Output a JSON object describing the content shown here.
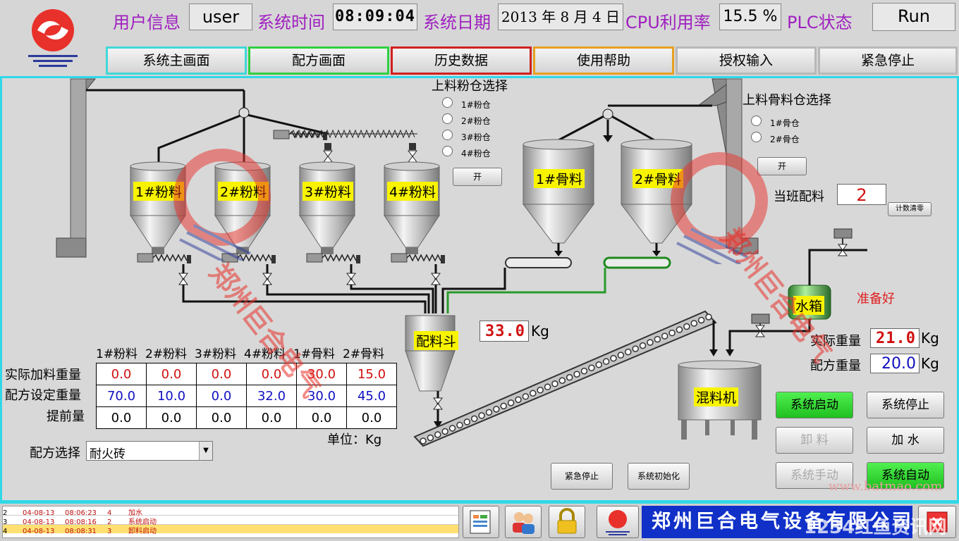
{
  "header": {
    "user_label": "用户信息",
    "user_value": "user",
    "time_label": "系统时间",
    "time_value": "08:09:04",
    "date_label": "系统日期",
    "date_value": "2013 年 8 月 4 日",
    "cpu_label": "CPU利用率",
    "cpu_value": "15.5 %",
    "plc_label": "PLC状态",
    "plc_value": "Run"
  },
  "nav": [
    {
      "label": "系统主画面",
      "color": "#40d8d8"
    },
    {
      "label": "配方画面",
      "color": "#30d040"
    },
    {
      "label": "历史数据",
      "color": "#d02020"
    },
    {
      "label": "使用帮助",
      "color": "#e8a020"
    },
    {
      "label": "授权输入",
      "color": "#b0b0b0"
    },
    {
      "label": "紧急停止",
      "color": "#b0b0b0"
    }
  ],
  "powder_select": {
    "title": "上料粉仓选择",
    "options": [
      "1#粉仓",
      "2#粉仓",
      "3#粉仓",
      "4#粉仓"
    ],
    "open_label": "开"
  },
  "aggregate_select": {
    "title": "上料骨料仓选择",
    "options": [
      "1#骨仓",
      "2#骨仓"
    ],
    "open_label": "开"
  },
  "shift_batch": {
    "label": "当班配料",
    "value": "2",
    "reset_label": "计数清零"
  },
  "tanks": {
    "powder": [
      "1#粉料",
      "2#粉料",
      "3#粉料",
      "4#粉料"
    ],
    "aggregate": [
      "1#骨料",
      "2#骨料"
    ],
    "batch_hopper": "配料斗",
    "water_tank": "水箱",
    "mixer": "混料机"
  },
  "hopper_weight": {
    "value": "33.0",
    "unit": "Kg"
  },
  "water": {
    "ready_text": "准备好",
    "actual_label": "实际重量",
    "actual_value": "21.0",
    "recipe_label": "配方重量",
    "recipe_value": "20.0",
    "unit": "Kg"
  },
  "table": {
    "columns": [
      "1#粉料",
      "2#粉料",
      "3#粉料",
      "4#粉料",
      "1#骨料",
      "2#骨料"
    ],
    "rows": [
      {
        "label": "实际加料重量",
        "values": [
          "0.0",
          "0.0",
          "0.0",
          "0.0",
          "30.0",
          "15.0"
        ],
        "color": "#d01010"
      },
      {
        "label": "配方设定重量",
        "values": [
          "70.0",
          "10.0",
          "0.0",
          "32.0",
          "30.0",
          "45.0"
        ],
        "color": "#1010c0"
      },
      {
        "label": "提前量",
        "values": [
          "0.0",
          "0.0",
          "0.0",
          "0.0",
          "0.0",
          "0.0"
        ],
        "color": "#000000"
      }
    ],
    "unit": "单位：Kg"
  },
  "recipe_select": {
    "label": "配方选择",
    "value": "耐火砖"
  },
  "controls": {
    "system_start": "系统启动",
    "system_stop": "系统停止",
    "unload": "卸 料",
    "add_water": "加 水",
    "system_manual": "系统手动",
    "system_auto": "系统自动",
    "emergency_stop": "紧急停止",
    "system_init": "系统初始化"
  },
  "alarms": [
    {
      "no": "2",
      "date": "04-08-13",
      "time": "08:06:23",
      "code": "4",
      "text": "加水"
    },
    {
      "no": "3",
      "date": "04-08-13",
      "time": "08:08:16",
      "code": "2",
      "text": "系统启动"
    },
    {
      "no": "4",
      "date": "04-08-13",
      "time": "08:08:31",
      "code": "3",
      "text": "卸料启动"
    }
  ],
  "banner": {
    "company": "郑州巨合电气设备有限公司"
  },
  "watermark": {
    "text": "郑州巨合电气",
    "url": "www.batmao.com",
    "corner": "1234红鱼资讯网"
  }
}
